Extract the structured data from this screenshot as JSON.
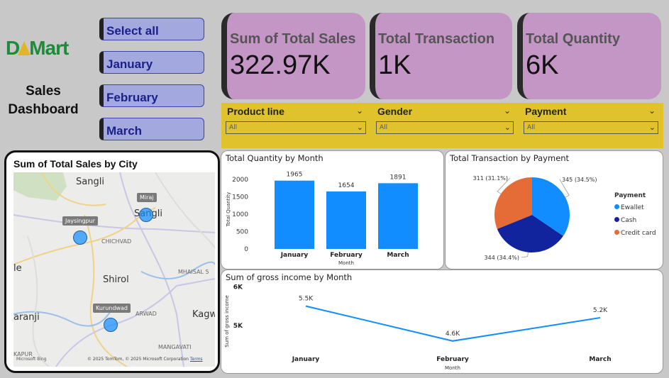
{
  "brand": {
    "logo_left": "D",
    "logo_right": "Mart"
  },
  "dashboard_title": "Sales Dashboard",
  "month_slicer": [
    "Select all",
    "January",
    "February",
    "March"
  ],
  "kpis": [
    {
      "label": "Sum of Total Sales",
      "value": "322.97K"
    },
    {
      "label": "Total Transaction",
      "value": "1K"
    },
    {
      "label": "Total Quantity",
      "value": "6K"
    }
  ],
  "filters": [
    {
      "title": "Product line",
      "value": "All"
    },
    {
      "title": "Gender",
      "value": "All"
    },
    {
      "title": "Payment",
      "value": "All"
    }
  ],
  "map_card": {
    "title": "Sum of Total Sales by City",
    "place_labels": [
      "Sangli",
      "Sangli",
      "CHICHVAD",
      "Shirol",
      "MHAISAL 5",
      "Kagw",
      "le",
      "aranji",
      "KAPUR",
      "ARWAD",
      "MANGAVATI"
    ],
    "city_tags": [
      "Miraj",
      "Jaysingpur",
      "Kurundwad"
    ],
    "attribution": "© 2025 TomTom, © 2025 Microsoft Corporation",
    "terms": "Terms",
    "bing": "Microsoft Bing"
  },
  "chart_data": [
    {
      "type": "bar",
      "title": "Total Quantity by Month",
      "xlabel": "Month",
      "ylabel": "Total Quantity",
      "categories": [
        "January",
        "February",
        "March"
      ],
      "values": [
        1965,
        1654,
        1891
      ],
      "data_labels": [
        "1965",
        "1654",
        "1891"
      ],
      "ylim": [
        0,
        2000
      ],
      "yticks": [
        "0",
        "500",
        "1000",
        "1500",
        "2000"
      ],
      "color": "#118dff"
    },
    {
      "type": "pie",
      "title": "Total Transaction by Payment",
      "legend_title": "Payment",
      "categories": [
        "Ewallet",
        "Cash",
        "Credit card"
      ],
      "values": [
        345,
        344,
        311
      ],
      "data_labels": [
        "345 (34.5%)",
        "344 (34.4%)",
        "311 (31.1%)"
      ],
      "colors": [
        "#118dff",
        "#12239e",
        "#e66c37"
      ],
      "legend_placement": "right"
    },
    {
      "type": "line",
      "title": "Sum of gross income by Month",
      "xlabel": "Month",
      "ylabel": "Sum of gross income",
      "categories": [
        "January",
        "February",
        "March"
      ],
      "values": [
        5500,
        4600,
        5200
      ],
      "data_labels": [
        "5.5K",
        "4.6K",
        "5.2K"
      ],
      "ylim": [
        4450,
        5950
      ],
      "yticks": [
        "6K",
        "5K"
      ],
      "color": "#118dff"
    }
  ]
}
